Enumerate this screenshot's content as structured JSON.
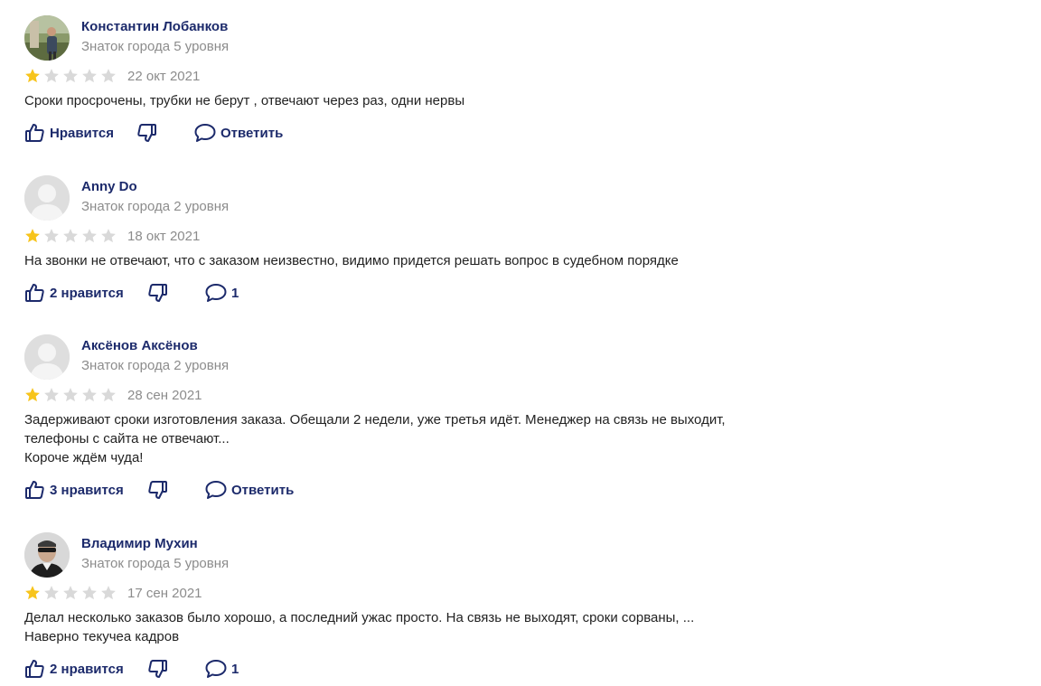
{
  "ui": {
    "star_filled": "#f7c41c",
    "star_empty": "#d9d9d9",
    "link_color": "#1c2a6b"
  },
  "reviews": [
    {
      "author": "Константин Лобанков",
      "level": "Знаток города 5 уровня",
      "rating": 1,
      "date": "22 окт 2021",
      "text": [
        "Сроки просрочены, трубки не берут , отвечают через раз, одни нервы"
      ],
      "like_label": "Нравится",
      "comment_label": "Ответить",
      "avatar": "photo-outdoor"
    },
    {
      "author": "Anny Do",
      "level": "Знаток города 2 уровня",
      "rating": 1,
      "date": "18 окт 2021",
      "text": [
        "На звонки не отвечают, что с заказом неизвестно, видимо придется решать вопрос в судебном порядке"
      ],
      "like_label": "2 нравится",
      "comment_label": "1",
      "avatar": "placeholder"
    },
    {
      "author": "Аксёнов Аксёнов",
      "level": "Знаток города 2 уровня",
      "rating": 1,
      "date": "28 сен 2021",
      "text": [
        "Задерживают сроки изготовления заказа. Обещали 2 недели, уже третья идёт. Менеджер на связь не выходит,",
        "телефоны с сайта не отвечают...",
        "Короче ждём чуда!"
      ],
      "like_label": "3 нравится",
      "comment_label": "Ответить",
      "avatar": "placeholder"
    },
    {
      "author": "Владимир Мухин",
      "level": "Знаток города 5 уровня",
      "rating": 1,
      "date": "17 сен 2021",
      "text": [
        "Делал несколько заказов было хорошо, а последний ужас просто. На связь не выходят, сроки сорваны, ...",
        "Наверно текучеа кадров"
      ],
      "like_label": "2 нравится",
      "comment_label": "1",
      "avatar": "photo-man-sunglasses"
    }
  ]
}
